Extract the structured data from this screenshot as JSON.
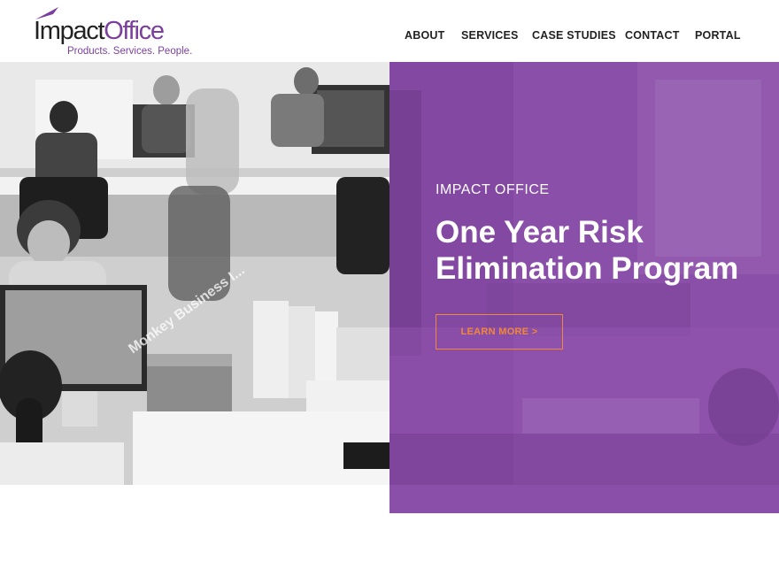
{
  "brand": {
    "logo_part1": "Impact",
    "logo_part2": "Office",
    "tagline": "Products. Services. People.",
    "purple": "#7b3f9e",
    "accent_orange": "#f0873a"
  },
  "nav": {
    "items": [
      "ABOUT",
      "SERVICES",
      "CASE STUDIES",
      "CONTACT",
      "PORTAL"
    ]
  },
  "hero": {
    "eyebrow": "IMPACT OFFICE",
    "title": "One Year Risk Elimination Program",
    "cta_label": "LEARN MORE   >",
    "panel_color": "#8a4fa8"
  },
  "photo": {
    "watermark": "Monkey Business I..."
  }
}
